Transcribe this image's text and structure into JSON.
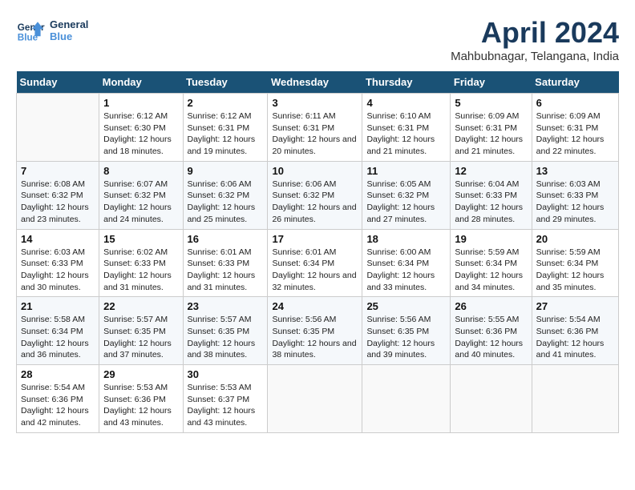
{
  "logo": {
    "line1": "General",
    "line2": "Blue"
  },
  "title": "April 2024",
  "location": "Mahbubnagar, Telangana, India",
  "weekdays": [
    "Sunday",
    "Monday",
    "Tuesday",
    "Wednesday",
    "Thursday",
    "Friday",
    "Saturday"
  ],
  "weeks": [
    [
      {
        "day": "",
        "sunrise": "",
        "sunset": "",
        "daylight": ""
      },
      {
        "day": "1",
        "sunrise": "Sunrise: 6:12 AM",
        "sunset": "Sunset: 6:30 PM",
        "daylight": "Daylight: 12 hours and 18 minutes."
      },
      {
        "day": "2",
        "sunrise": "Sunrise: 6:12 AM",
        "sunset": "Sunset: 6:31 PM",
        "daylight": "Daylight: 12 hours and 19 minutes."
      },
      {
        "day": "3",
        "sunrise": "Sunrise: 6:11 AM",
        "sunset": "Sunset: 6:31 PM",
        "daylight": "Daylight: 12 hours and 20 minutes."
      },
      {
        "day": "4",
        "sunrise": "Sunrise: 6:10 AM",
        "sunset": "Sunset: 6:31 PM",
        "daylight": "Daylight: 12 hours and 21 minutes."
      },
      {
        "day": "5",
        "sunrise": "Sunrise: 6:09 AM",
        "sunset": "Sunset: 6:31 PM",
        "daylight": "Daylight: 12 hours and 21 minutes."
      },
      {
        "day": "6",
        "sunrise": "Sunrise: 6:09 AM",
        "sunset": "Sunset: 6:31 PM",
        "daylight": "Daylight: 12 hours and 22 minutes."
      }
    ],
    [
      {
        "day": "7",
        "sunrise": "Sunrise: 6:08 AM",
        "sunset": "Sunset: 6:32 PM",
        "daylight": "Daylight: 12 hours and 23 minutes."
      },
      {
        "day": "8",
        "sunrise": "Sunrise: 6:07 AM",
        "sunset": "Sunset: 6:32 PM",
        "daylight": "Daylight: 12 hours and 24 minutes."
      },
      {
        "day": "9",
        "sunrise": "Sunrise: 6:06 AM",
        "sunset": "Sunset: 6:32 PM",
        "daylight": "Daylight: 12 hours and 25 minutes."
      },
      {
        "day": "10",
        "sunrise": "Sunrise: 6:06 AM",
        "sunset": "Sunset: 6:32 PM",
        "daylight": "Daylight: 12 hours and 26 minutes."
      },
      {
        "day": "11",
        "sunrise": "Sunrise: 6:05 AM",
        "sunset": "Sunset: 6:32 PM",
        "daylight": "Daylight: 12 hours and 27 minutes."
      },
      {
        "day": "12",
        "sunrise": "Sunrise: 6:04 AM",
        "sunset": "Sunset: 6:33 PM",
        "daylight": "Daylight: 12 hours and 28 minutes."
      },
      {
        "day": "13",
        "sunrise": "Sunrise: 6:03 AM",
        "sunset": "Sunset: 6:33 PM",
        "daylight": "Daylight: 12 hours and 29 minutes."
      }
    ],
    [
      {
        "day": "14",
        "sunrise": "Sunrise: 6:03 AM",
        "sunset": "Sunset: 6:33 PM",
        "daylight": "Daylight: 12 hours and 30 minutes."
      },
      {
        "day": "15",
        "sunrise": "Sunrise: 6:02 AM",
        "sunset": "Sunset: 6:33 PM",
        "daylight": "Daylight: 12 hours and 31 minutes."
      },
      {
        "day": "16",
        "sunrise": "Sunrise: 6:01 AM",
        "sunset": "Sunset: 6:33 PM",
        "daylight": "Daylight: 12 hours and 31 minutes."
      },
      {
        "day": "17",
        "sunrise": "Sunrise: 6:01 AM",
        "sunset": "Sunset: 6:34 PM",
        "daylight": "Daylight: 12 hours and 32 minutes."
      },
      {
        "day": "18",
        "sunrise": "Sunrise: 6:00 AM",
        "sunset": "Sunset: 6:34 PM",
        "daylight": "Daylight: 12 hours and 33 minutes."
      },
      {
        "day": "19",
        "sunrise": "Sunrise: 5:59 AM",
        "sunset": "Sunset: 6:34 PM",
        "daylight": "Daylight: 12 hours and 34 minutes."
      },
      {
        "day": "20",
        "sunrise": "Sunrise: 5:59 AM",
        "sunset": "Sunset: 6:34 PM",
        "daylight": "Daylight: 12 hours and 35 minutes."
      }
    ],
    [
      {
        "day": "21",
        "sunrise": "Sunrise: 5:58 AM",
        "sunset": "Sunset: 6:34 PM",
        "daylight": "Daylight: 12 hours and 36 minutes."
      },
      {
        "day": "22",
        "sunrise": "Sunrise: 5:57 AM",
        "sunset": "Sunset: 6:35 PM",
        "daylight": "Daylight: 12 hours and 37 minutes."
      },
      {
        "day": "23",
        "sunrise": "Sunrise: 5:57 AM",
        "sunset": "Sunset: 6:35 PM",
        "daylight": "Daylight: 12 hours and 38 minutes."
      },
      {
        "day": "24",
        "sunrise": "Sunrise: 5:56 AM",
        "sunset": "Sunset: 6:35 PM",
        "daylight": "Daylight: 12 hours and 38 minutes."
      },
      {
        "day": "25",
        "sunrise": "Sunrise: 5:56 AM",
        "sunset": "Sunset: 6:35 PM",
        "daylight": "Daylight: 12 hours and 39 minutes."
      },
      {
        "day": "26",
        "sunrise": "Sunrise: 5:55 AM",
        "sunset": "Sunset: 6:36 PM",
        "daylight": "Daylight: 12 hours and 40 minutes."
      },
      {
        "day": "27",
        "sunrise": "Sunrise: 5:54 AM",
        "sunset": "Sunset: 6:36 PM",
        "daylight": "Daylight: 12 hours and 41 minutes."
      }
    ],
    [
      {
        "day": "28",
        "sunrise": "Sunrise: 5:54 AM",
        "sunset": "Sunset: 6:36 PM",
        "daylight": "Daylight: 12 hours and 42 minutes."
      },
      {
        "day": "29",
        "sunrise": "Sunrise: 5:53 AM",
        "sunset": "Sunset: 6:36 PM",
        "daylight": "Daylight: 12 hours and 43 minutes."
      },
      {
        "day": "30",
        "sunrise": "Sunrise: 5:53 AM",
        "sunset": "Sunset: 6:37 PM",
        "daylight": "Daylight: 12 hours and 43 minutes."
      },
      {
        "day": "",
        "sunrise": "",
        "sunset": "",
        "daylight": ""
      },
      {
        "day": "",
        "sunrise": "",
        "sunset": "",
        "daylight": ""
      },
      {
        "day": "",
        "sunrise": "",
        "sunset": "",
        "daylight": ""
      },
      {
        "day": "",
        "sunrise": "",
        "sunset": "",
        "daylight": ""
      }
    ]
  ]
}
